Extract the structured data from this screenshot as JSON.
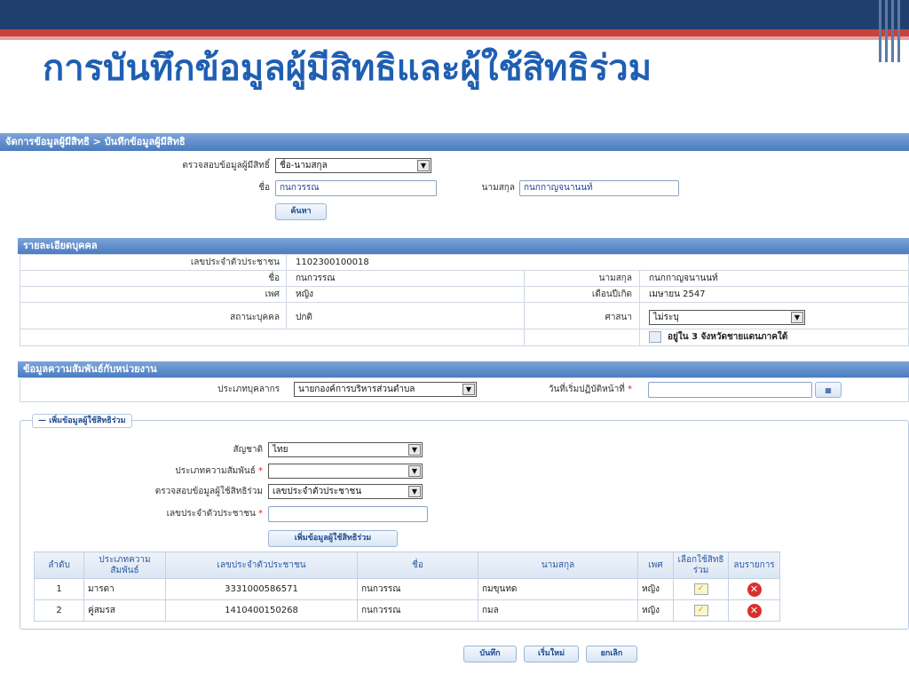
{
  "slide": {
    "title": "การบันทึกข้อมูลผู้มีสิทธิและผู้ใช้สิทธิร่วม"
  },
  "breadcrumb": "จัดการข้อมูลผู้มีสิทธิ > บันทึกข้อมูลผู้มีสิทธิ",
  "search": {
    "check_label": "ตรวจสอบข้อมูลผู้มีสิทธิ์",
    "check_value": "ชื่อ-นามสกุล",
    "name_label": "ชื่อ",
    "name_value": "กนกวรรณ",
    "surname_label": "นามสกุล",
    "surname_value": "กนกกาญจนานนท์",
    "search_button": "ค้นหา"
  },
  "person": {
    "header": "รายละเอียดบุคคล",
    "id_label": "เลขประจำตัวประชาชน",
    "id_value": "1102300100018",
    "name_label": "ชื่อ",
    "name_value": "กนกวรรณ",
    "surname_label": "นามสกุล",
    "surname_value": "กนกกาญจนานนท์",
    "sex_label": "เพศ",
    "sex_value": "หญิง",
    "birth_label": "เดือนปีเกิด",
    "birth_value": "เมษายน 2547",
    "status_label": "สถานะบุคคล",
    "status_value": "ปกติ",
    "religion_label": "ศาสนา",
    "religion_value": "ไม่ระบุ",
    "south_label": "อยู่ใน 3 จังหวัดชายแดนภาคใต้"
  },
  "agency": {
    "header": "ข้อมูลความสัมพันธ์กับหน่วยงาน",
    "type_label": "ประเภทบุคลากร",
    "type_value": "นายกองค์การบริหารส่วนตำบล",
    "start_label": "วันที่เริ่มปฏิบัติหน้าที่",
    "start_value": ""
  },
  "co_user": {
    "legend": "— เพิ่มข้อมูลผู้ใช้สิทธิร่วม",
    "nation_label": "สัญชาติ",
    "nation_value": "ไทย",
    "relation_label": "ประเภทความสัมพันธ์",
    "relation_value": "",
    "check_label": "ตรวจสอบข้อมูลผู้ใช้สิทธิร่วม",
    "check_value": "เลขประจำตัวประชาชน",
    "id_label": "เลขประจำตัวประชาชน",
    "id_value": "",
    "add_button": "เพิ่มข้อมูลผู้ใช้สิทธิร่วม"
  },
  "table": {
    "headers": [
      "ลำดับ",
      "ประเภทความสัมพันธ์",
      "เลขประจำตัวประชาชน",
      "ชื่อ",
      "นามสกุล",
      "เพศ",
      "เลือกใช้สิทธิร่วม",
      "ลบรายการ"
    ],
    "rows": [
      {
        "no": "1",
        "relation": "มารดา",
        "id": "3331000586571",
        "name": "กนกวรรณ",
        "surname": "กมขุนทด",
        "sex": "หญิง"
      },
      {
        "no": "2",
        "relation": "คู่สมรส",
        "id": "1410400150268",
        "name": "กนกวรรณ",
        "surname": "กมล",
        "sex": "หญิง"
      }
    ]
  },
  "actions": {
    "save": "บันทึก",
    "reset": "เริ่มใหม่",
    "cancel": "ยกเลิก"
  },
  "colors": {
    "title": "#1f5fb3",
    "header_bar": "#1f3f6e",
    "accent_red": "#c9413c",
    "section_header": "#4a7cc0"
  }
}
